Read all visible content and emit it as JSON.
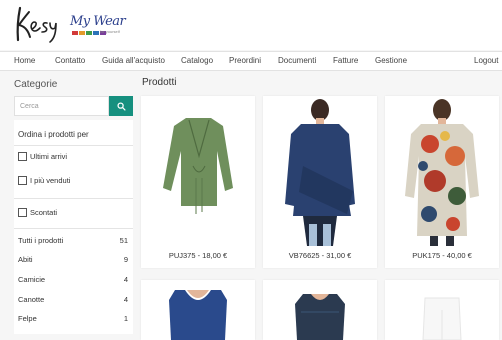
{
  "header": {
    "logo_kesy": "Kesy",
    "logo_mywear": "My Wear",
    "logo_mywear_sub": "for yourself",
    "brand_bar_colors": [
      "#d23a3a",
      "#e39a2a",
      "#3f9a4a",
      "#2b73b8",
      "#7a3e9b"
    ]
  },
  "nav": {
    "items": [
      {
        "label": "Home"
      },
      {
        "label": "Contatto"
      },
      {
        "label": "Guida all'acquisto"
      },
      {
        "label": "Catalogo"
      },
      {
        "label": "Preordini"
      },
      {
        "label": "Documenti"
      },
      {
        "label": "Fatture"
      },
      {
        "label": "Gestione"
      },
      {
        "label": "Logout"
      }
    ]
  },
  "sidebar": {
    "title": "Categorie",
    "search_placeholder": "Cerca",
    "search_icon": "search-icon",
    "sort_label": "Ordina i prodotti per",
    "sort_options": [
      {
        "label": "Ultimi arrivi"
      },
      {
        "label": "I più venduti"
      }
    ],
    "discount_label": "Scontati",
    "categories": [
      {
        "name": "Tutti i prodotti",
        "count": "51"
      },
      {
        "name": "Abiti",
        "count": "9"
      },
      {
        "name": "Camicie",
        "count": "4"
      },
      {
        "name": "Canotte",
        "count": "4"
      },
      {
        "name": "Felpe",
        "count": "1"
      }
    ]
  },
  "main": {
    "title": "Prodotti",
    "products": [
      {
        "caption": "PUJ375 - 18,00 €"
      },
      {
        "caption": "VB76625 - 31,00 €"
      },
      {
        "caption": "PUK175 - 40,00 €"
      }
    ]
  },
  "colors": {
    "accent": "#16907f"
  }
}
